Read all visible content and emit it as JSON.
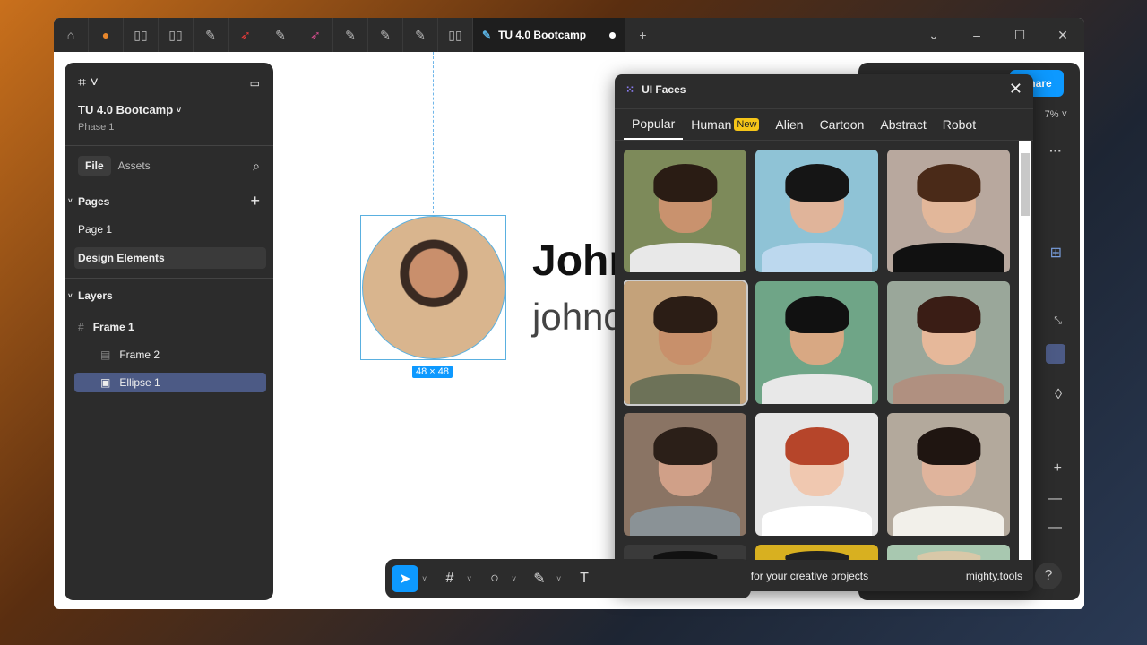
{
  "window": {
    "active_tab": "TU 4.0 Bootcamp",
    "tab_icons": [
      "home-icon",
      "flame-icon",
      "book-icon",
      "book-icon",
      "pen-icon",
      "rocket-icon",
      "pen-icon",
      "rocket-icon",
      "pen-icon",
      "pen-icon",
      "pen-icon",
      "book-icon"
    ],
    "new_tab": "+",
    "controls": [
      "⌄",
      "–",
      "☐",
      "✕"
    ]
  },
  "left_panel": {
    "file_name": "TU 4.0 Bootcamp",
    "project": "Phase 1",
    "tabs": [
      "File",
      "Assets"
    ],
    "pages_heading": "Pages",
    "pages": [
      "Page 1",
      "Design Elements"
    ],
    "layers_heading": "Layers",
    "layers": [
      {
        "name": "Frame 1",
        "icon": "#"
      },
      {
        "name": "Frame 2",
        "icon": "▤"
      },
      {
        "name": "Ellipse 1",
        "icon": "▣"
      }
    ]
  },
  "canvas": {
    "title": "John",
    "subtitle": "johnd",
    "size_badge": "48 × 48"
  },
  "right_panel": {
    "share": "Share",
    "zoom": "7%"
  },
  "plugin": {
    "title": "UI Faces",
    "tabs": [
      "Popular",
      "Human",
      "Alien",
      "Cartoon",
      "Abstract",
      "Robot"
    ],
    "new_badge": "New",
    "footer_text": "Free AI-generated avatars for your creative projects",
    "footer_link": "mighty.tools",
    "help": "?"
  },
  "toolbar": {
    "text_tool": "T"
  },
  "colors": {
    "accent": "#0d99ff",
    "selection": "#4c5a85"
  }
}
